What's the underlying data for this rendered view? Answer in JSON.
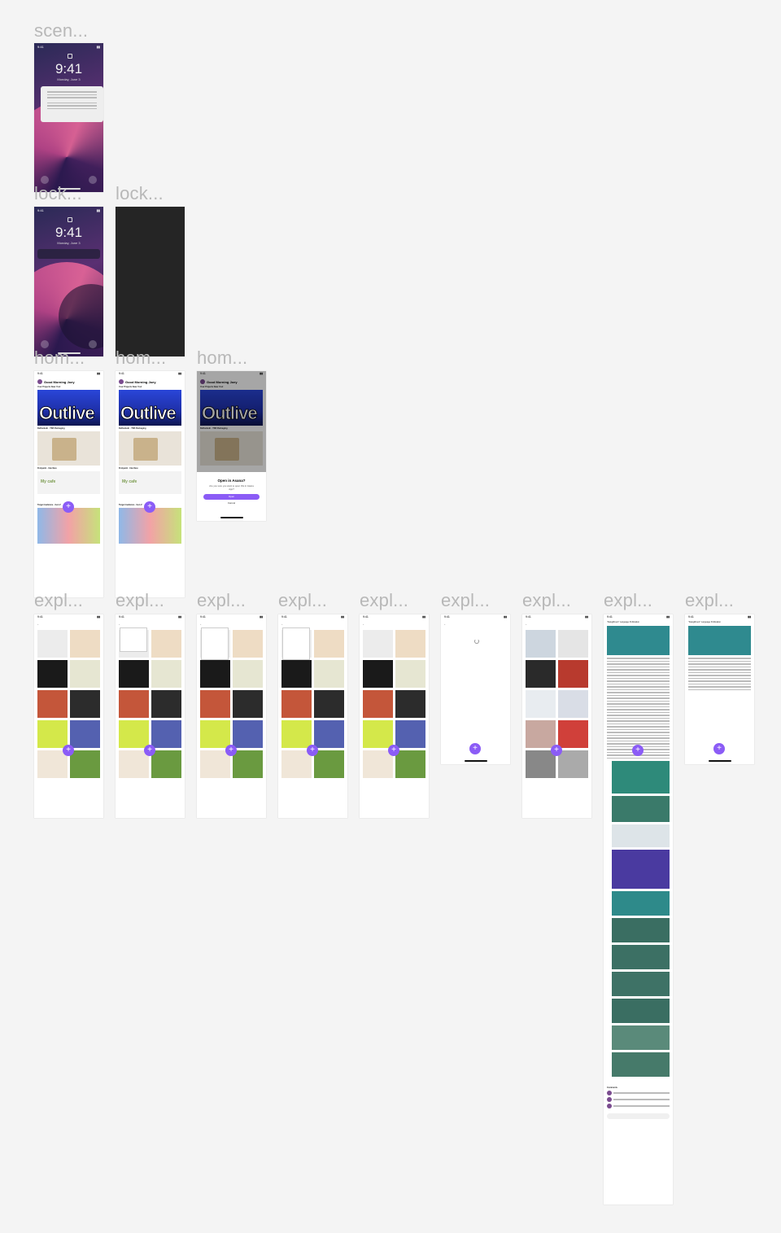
{
  "labels": {
    "scene": "scen...",
    "lock_a": "lock...",
    "lock_b": "lock...",
    "home_a": "hom...",
    "home_b": "hom...",
    "home_c": "hom...",
    "explore": [
      "expl...",
      "expl...",
      "expl...",
      "expl...",
      "expl...",
      "expl...",
      "expl...",
      "expl...",
      "expl..."
    ]
  },
  "lockscreen": {
    "time": "9:41",
    "date": "Monday, June 3",
    "status_time": "9:41"
  },
  "home": {
    "status_time": "9:41",
    "greeting": "Good Morning Joey",
    "section": "Your Projects Near You!",
    "hero_text": "Outlive",
    "pack_caption": "DeDonkeln - TSB Packaging",
    "cafe_caption": "Fishpaint - Interface",
    "cafe_text": "My cafe",
    "target_caption": "Target Audience - Gen Z",
    "fab": "+"
  },
  "modal": {
    "title": "Open in Asana?",
    "subtitle": "Are you sure you want to open this in Asana App?",
    "confirm": "Open",
    "cancel": "Cancel"
  },
  "explore": {
    "status_time": "9:41",
    "article_title": "\"Deleg8ment\" Language Publication",
    "comments_label": "Comments"
  },
  "colors": {
    "accent": "#8b5cf6",
    "canvas": "#f4f4f4",
    "label": "#b8b8b8"
  }
}
